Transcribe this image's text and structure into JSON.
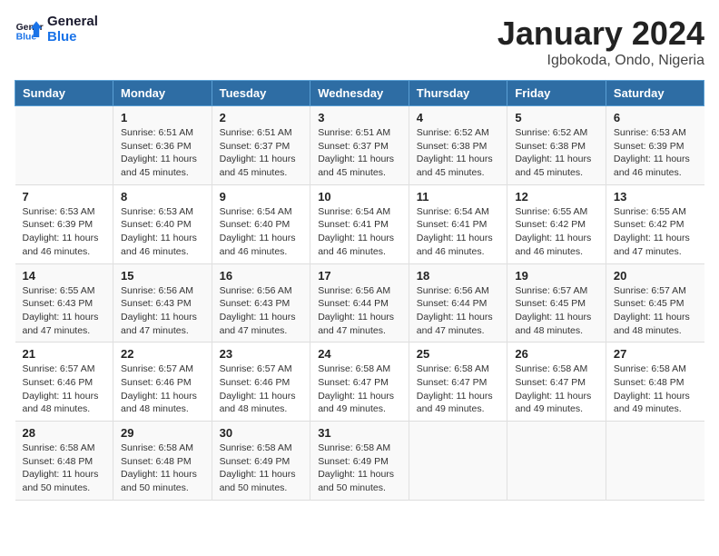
{
  "logo": {
    "text_general": "General",
    "text_blue": "Blue"
  },
  "header": {
    "title": "January 2024",
    "subtitle": "Igbokoda, Ondo, Nigeria"
  },
  "weekdays": [
    "Sunday",
    "Monday",
    "Tuesday",
    "Wednesday",
    "Thursday",
    "Friday",
    "Saturday"
  ],
  "weeks": [
    [
      {
        "day": "",
        "sunrise": "",
        "sunset": "",
        "daylight": ""
      },
      {
        "day": "1",
        "sunrise": "Sunrise: 6:51 AM",
        "sunset": "Sunset: 6:36 PM",
        "daylight": "Daylight: 11 hours and 45 minutes."
      },
      {
        "day": "2",
        "sunrise": "Sunrise: 6:51 AM",
        "sunset": "Sunset: 6:37 PM",
        "daylight": "Daylight: 11 hours and 45 minutes."
      },
      {
        "day": "3",
        "sunrise": "Sunrise: 6:51 AM",
        "sunset": "Sunset: 6:37 PM",
        "daylight": "Daylight: 11 hours and 45 minutes."
      },
      {
        "day": "4",
        "sunrise": "Sunrise: 6:52 AM",
        "sunset": "Sunset: 6:38 PM",
        "daylight": "Daylight: 11 hours and 45 minutes."
      },
      {
        "day": "5",
        "sunrise": "Sunrise: 6:52 AM",
        "sunset": "Sunset: 6:38 PM",
        "daylight": "Daylight: 11 hours and 45 minutes."
      },
      {
        "day": "6",
        "sunrise": "Sunrise: 6:53 AM",
        "sunset": "Sunset: 6:39 PM",
        "daylight": "Daylight: 11 hours and 46 minutes."
      }
    ],
    [
      {
        "day": "7",
        "sunrise": "Sunrise: 6:53 AM",
        "sunset": "Sunset: 6:39 PM",
        "daylight": "Daylight: 11 hours and 46 minutes."
      },
      {
        "day": "8",
        "sunrise": "Sunrise: 6:53 AM",
        "sunset": "Sunset: 6:40 PM",
        "daylight": "Daylight: 11 hours and 46 minutes."
      },
      {
        "day": "9",
        "sunrise": "Sunrise: 6:54 AM",
        "sunset": "Sunset: 6:40 PM",
        "daylight": "Daylight: 11 hours and 46 minutes."
      },
      {
        "day": "10",
        "sunrise": "Sunrise: 6:54 AM",
        "sunset": "Sunset: 6:41 PM",
        "daylight": "Daylight: 11 hours and 46 minutes."
      },
      {
        "day": "11",
        "sunrise": "Sunrise: 6:54 AM",
        "sunset": "Sunset: 6:41 PM",
        "daylight": "Daylight: 11 hours and 46 minutes."
      },
      {
        "day": "12",
        "sunrise": "Sunrise: 6:55 AM",
        "sunset": "Sunset: 6:42 PM",
        "daylight": "Daylight: 11 hours and 46 minutes."
      },
      {
        "day": "13",
        "sunrise": "Sunrise: 6:55 AM",
        "sunset": "Sunset: 6:42 PM",
        "daylight": "Daylight: 11 hours and 47 minutes."
      }
    ],
    [
      {
        "day": "14",
        "sunrise": "Sunrise: 6:55 AM",
        "sunset": "Sunset: 6:43 PM",
        "daylight": "Daylight: 11 hours and 47 minutes."
      },
      {
        "day": "15",
        "sunrise": "Sunrise: 6:56 AM",
        "sunset": "Sunset: 6:43 PM",
        "daylight": "Daylight: 11 hours and 47 minutes."
      },
      {
        "day": "16",
        "sunrise": "Sunrise: 6:56 AM",
        "sunset": "Sunset: 6:43 PM",
        "daylight": "Daylight: 11 hours and 47 minutes."
      },
      {
        "day": "17",
        "sunrise": "Sunrise: 6:56 AM",
        "sunset": "Sunset: 6:44 PM",
        "daylight": "Daylight: 11 hours and 47 minutes."
      },
      {
        "day": "18",
        "sunrise": "Sunrise: 6:56 AM",
        "sunset": "Sunset: 6:44 PM",
        "daylight": "Daylight: 11 hours and 47 minutes."
      },
      {
        "day": "19",
        "sunrise": "Sunrise: 6:57 AM",
        "sunset": "Sunset: 6:45 PM",
        "daylight": "Daylight: 11 hours and 48 minutes."
      },
      {
        "day": "20",
        "sunrise": "Sunrise: 6:57 AM",
        "sunset": "Sunset: 6:45 PM",
        "daylight": "Daylight: 11 hours and 48 minutes."
      }
    ],
    [
      {
        "day": "21",
        "sunrise": "Sunrise: 6:57 AM",
        "sunset": "Sunset: 6:46 PM",
        "daylight": "Daylight: 11 hours and 48 minutes."
      },
      {
        "day": "22",
        "sunrise": "Sunrise: 6:57 AM",
        "sunset": "Sunset: 6:46 PM",
        "daylight": "Daylight: 11 hours and 48 minutes."
      },
      {
        "day": "23",
        "sunrise": "Sunrise: 6:57 AM",
        "sunset": "Sunset: 6:46 PM",
        "daylight": "Daylight: 11 hours and 48 minutes."
      },
      {
        "day": "24",
        "sunrise": "Sunrise: 6:58 AM",
        "sunset": "Sunset: 6:47 PM",
        "daylight": "Daylight: 11 hours and 49 minutes."
      },
      {
        "day": "25",
        "sunrise": "Sunrise: 6:58 AM",
        "sunset": "Sunset: 6:47 PM",
        "daylight": "Daylight: 11 hours and 49 minutes."
      },
      {
        "day": "26",
        "sunrise": "Sunrise: 6:58 AM",
        "sunset": "Sunset: 6:47 PM",
        "daylight": "Daylight: 11 hours and 49 minutes."
      },
      {
        "day": "27",
        "sunrise": "Sunrise: 6:58 AM",
        "sunset": "Sunset: 6:48 PM",
        "daylight": "Daylight: 11 hours and 49 minutes."
      }
    ],
    [
      {
        "day": "28",
        "sunrise": "Sunrise: 6:58 AM",
        "sunset": "Sunset: 6:48 PM",
        "daylight": "Daylight: 11 hours and 50 minutes."
      },
      {
        "day": "29",
        "sunrise": "Sunrise: 6:58 AM",
        "sunset": "Sunset: 6:48 PM",
        "daylight": "Daylight: 11 hours and 50 minutes."
      },
      {
        "day": "30",
        "sunrise": "Sunrise: 6:58 AM",
        "sunset": "Sunset: 6:49 PM",
        "daylight": "Daylight: 11 hours and 50 minutes."
      },
      {
        "day": "31",
        "sunrise": "Sunrise: 6:58 AM",
        "sunset": "Sunset: 6:49 PM",
        "daylight": "Daylight: 11 hours and 50 minutes."
      },
      {
        "day": "",
        "sunrise": "",
        "sunset": "",
        "daylight": ""
      },
      {
        "day": "",
        "sunrise": "",
        "sunset": "",
        "daylight": ""
      },
      {
        "day": "",
        "sunrise": "",
        "sunset": "",
        "daylight": ""
      }
    ]
  ]
}
